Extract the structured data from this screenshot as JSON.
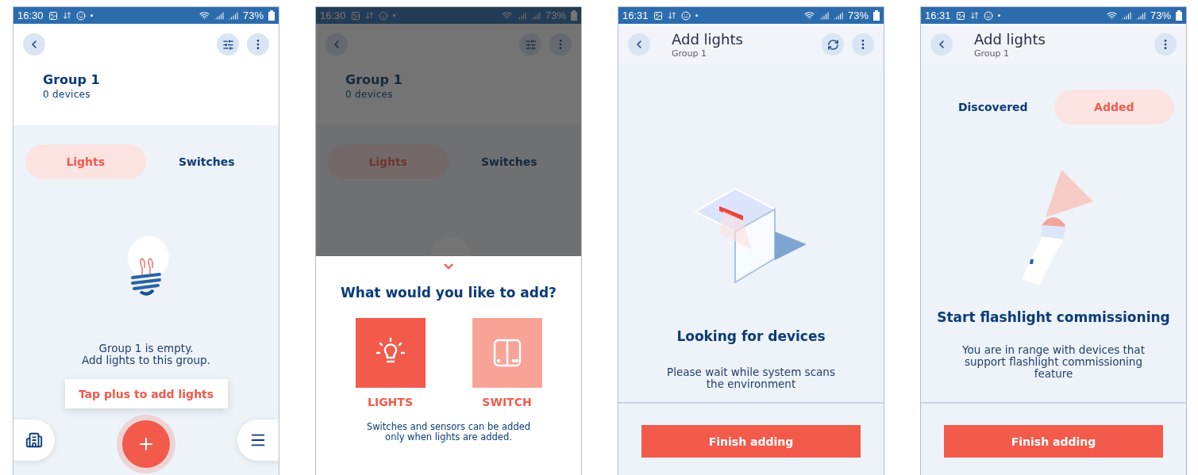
{
  "screens": [
    {
      "kind": "group",
      "status": {
        "time": "16:30",
        "battery": "73%"
      },
      "actions": [
        {
          "kind": "filter"
        },
        {
          "kind": "more"
        }
      ],
      "title": "Group 1",
      "subtitle": "0 devices",
      "tabs": [
        {
          "label": "Lights",
          "selected": true
        },
        {
          "label": "Switches",
          "selected": false
        }
      ],
      "message": [
        "Group 1 is empty.",
        "Add lights to this group."
      ],
      "tooltip": "Tap plus to add lights"
    },
    {
      "kind": "add_sheet",
      "dimmed": true,
      "status": {
        "time": "16:30",
        "battery": "73%"
      },
      "actions": [
        {
          "kind": "filter"
        },
        {
          "kind": "more"
        }
      ],
      "title": "Group 1",
      "subtitle": "0 devices",
      "tabs": [
        {
          "label": "Lights",
          "selected": true
        },
        {
          "label": "Switches",
          "selected": false
        }
      ],
      "sheet": {
        "title": "What would you like to add?",
        "options": [
          {
            "kind": "light",
            "label": "LIGHTS",
            "disabled": false
          },
          {
            "kind": "switch",
            "label": "SWITCH",
            "disabled": true
          }
        ],
        "note": [
          "Switches and sensors can be added",
          "only when lights are added."
        ]
      }
    },
    {
      "kind": "scanning",
      "status": {
        "time": "16:31",
        "battery": "73%"
      },
      "actions": [
        {
          "kind": "refresh"
        },
        {
          "kind": "more"
        }
      ],
      "title": "Add lights",
      "subtitle": "Group 1",
      "heading": "Looking for devices",
      "body": [
        "Please wait while system scans",
        "the environment"
      ],
      "button": "Finish adding"
    },
    {
      "kind": "flashlight",
      "status": {
        "time": "16:31",
        "battery": "73%"
      },
      "actions": [
        {
          "kind": "more"
        }
      ],
      "title": "Add lights",
      "subtitle": "Group 1",
      "tabs": [
        {
          "label": "Discovered",
          "selected": false
        },
        {
          "label": "Added",
          "selected": true
        }
      ],
      "heading": "Start flashlight commissioning",
      "body": [
        "You are in range with devices that",
        "support flashlight commissioning",
        "feature"
      ],
      "button": "Finish adding"
    }
  ]
}
